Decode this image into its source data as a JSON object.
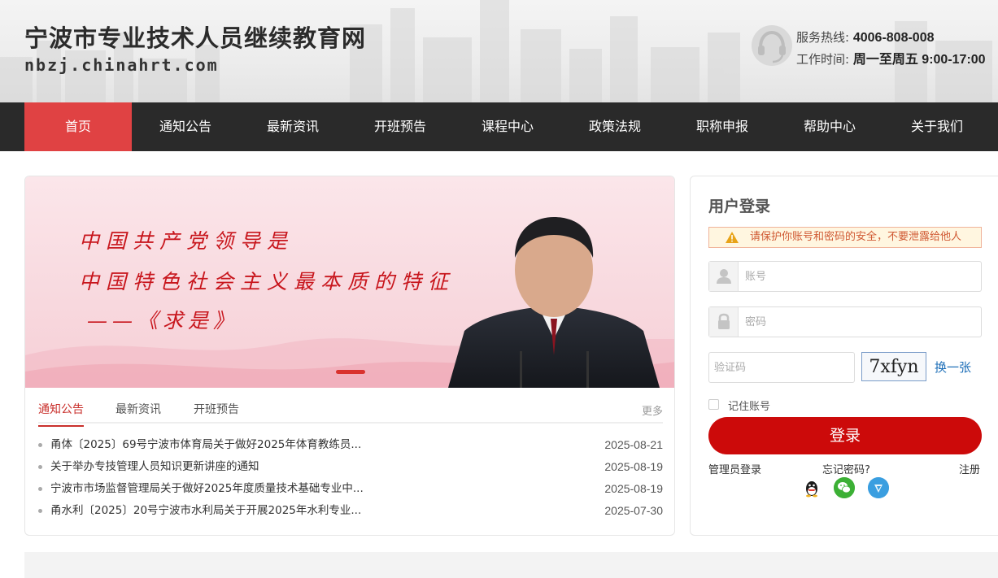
{
  "header": {
    "site_title": "宁波市专业技术人员继续教育网",
    "site_url": "nbzj.chinahrt.com",
    "hotline_label": "服务热线:",
    "hotline_value": "4006-808-008",
    "hours_label": "工作时间:",
    "hours_value": "周一至周五 9:00-17:00"
  },
  "nav": {
    "items": [
      {
        "label": "首页",
        "active": true
      },
      {
        "label": "通知公告"
      },
      {
        "label": "最新资讯"
      },
      {
        "label": "开班预告"
      },
      {
        "label": "课程中心"
      },
      {
        "label": "政策法规"
      },
      {
        "label": "职称申报"
      },
      {
        "label": "帮助中心"
      },
      {
        "label": "关于我们"
      }
    ]
  },
  "banner": {
    "line1": "中国共产党领导是",
    "line2": "中国特色社会主义最本质的特征",
    "line3": "——《求是》"
  },
  "news": {
    "tabs": [
      "通知公告",
      "最新资讯",
      "开班预告"
    ],
    "active_tab": "通知公告",
    "more_label": "更多",
    "items": [
      {
        "title": "甬体〔2025〕69号宁波市体育局关于做好2025年体育教练员...",
        "date": "2025-08-21"
      },
      {
        "title": "关于举办专技管理人员知识更新讲座的通知",
        "date": "2025-08-19"
      },
      {
        "title": "宁波市市场监督管理局关于做好2025年度质量技术基础专业中...",
        "date": "2025-08-19"
      },
      {
        "title": "甬水利〔2025〕20号宁波市水利局关于开展2025年水利专业...",
        "date": "2025-07-30"
      }
    ]
  },
  "login": {
    "title": "用户登录",
    "warning": "请保护你账号和密码的安全，不要泄露给他人",
    "username_placeholder": "账号",
    "password_placeholder": "密码",
    "captcha_placeholder": "验证码",
    "captcha_text": "7xfyn",
    "captcha_refresh": "换一张",
    "remember_label": "记住账号",
    "submit_label": "登录",
    "admin_login": "管理员登录",
    "forgot_password": "忘记密码?",
    "register": "注册",
    "social_icons": [
      "qq-icon",
      "wechat-icon",
      "weibo-icon"
    ]
  },
  "colors": {
    "nav_bg": "#2a2a2a",
    "nav_active": "#e04243",
    "login_button": "#cc0a0a",
    "accent_red": "#c9302c"
  }
}
